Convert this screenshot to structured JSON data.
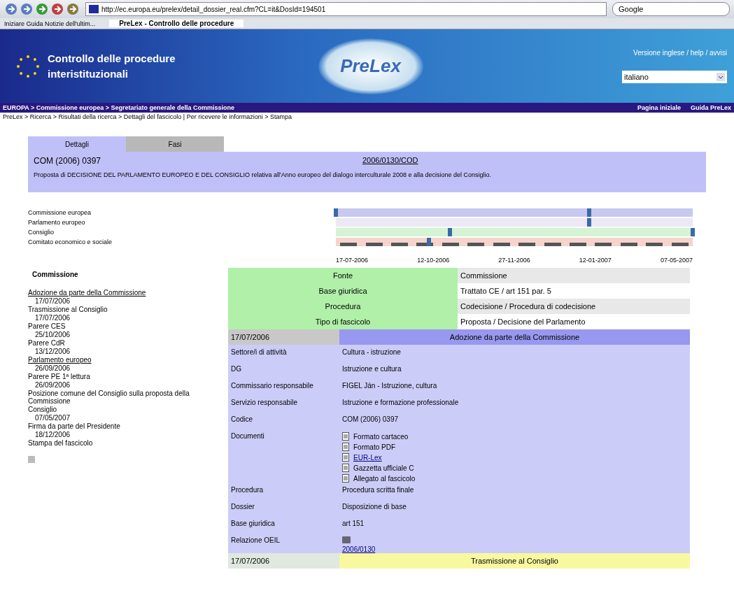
{
  "browser": {
    "url": "http://ec.europa.eu/prelex/detail_dossier_real.cfm?CL=it&DosId=194501",
    "search": "Google",
    "bookmarks": "Iniziare Guida Notizie dell'ultim..."
  },
  "tab": {
    "title": "PreLex - Controllo delle procedure"
  },
  "header": {
    "title": "Controllo delle procedure interistituzionali",
    "logo": "PreLex",
    "top_link": "Versione inglese / help / avvisi",
    "language": "italiano"
  },
  "nav_bar": {
    "left": "EUROPA > Commissione europea > Segretariato generale della Commissione",
    "right": [
      {
        "label": "Pagina iniziale"
      },
      {
        "label": "Guida PreLex"
      }
    ]
  },
  "breadcrumb": "PreLex > Ricerca > Risultati della ricerca > Dettagli del fascicolo | Per ricevere le informazioni > Stampa",
  "tabs": [
    {
      "label": "Dettagli",
      "selected": true
    },
    {
      "label": "Fasi",
      "selected": false
    }
  ],
  "dossier": {
    "label": "COM (2006) 0397",
    "link": "2006/0130/COD",
    "summary": "Proposta di DECISIONE DEL PARLAMENTO EUROPEO E DEL CONSIGLIO relativa all'Anno europeo del dialogo interculturale 2008 e alla decisione del Consiglio."
  },
  "timeline": {
    "rows": [
      {
        "label": "Commissione europea",
        "color": "#c8c8f0"
      },
      {
        "label": "Parlamento europeo",
        "color": "#ece8f4"
      },
      {
        "label": "Consiglio",
        "color": "#d4f4d4"
      },
      {
        "label": "Comitato economico e sociale",
        "color": "#f4d4cc"
      }
    ],
    "dates": [
      "17-07-2006",
      "12-10-2006",
      "27-11-2006",
      "12-01-2007",
      "07-05-2007"
    ]
  },
  "sidebar": {
    "title": "Commissione",
    "items": [
      {
        "text": "Adozione da parte della Commissione",
        "kind": "link"
      },
      {
        "text": "17/07/2006",
        "kind": "date"
      },
      {
        "text": "Trasmissione al Consiglio",
        "kind": "plain"
      },
      {
        "text": "17/07/2006",
        "kind": "date"
      },
      {
        "text": "Parere CES",
        "kind": "plain"
      },
      {
        "text": "25/10/2006",
        "kind": "date"
      },
      {
        "text": "Parere CdR",
        "kind": "plain"
      },
      {
        "text": "13/12/2006",
        "kind": "date"
      },
      {
        "text": "Parlamento europeo",
        "kind": "link"
      },
      {
        "text": "26/09/2006",
        "kind": "date"
      },
      {
        "text": "Parere PE 1ª lettura",
        "kind": "plain"
      },
      {
        "text": "26/09/2006",
        "kind": "date"
      },
      {
        "text": "Posizione comune del Consiglio sulla proposta della Commissione",
        "kind": "plain"
      },
      {
        "text": "Consiglio",
        "kind": "plain"
      },
      {
        "text": "07/05/2007",
        "kind": "date"
      },
      {
        "text": "Firma da parte del Presidente",
        "kind": "plain"
      },
      {
        "text": "18/12/2006",
        "kind": "date"
      },
      {
        "text": "Stampa del fascicolo",
        "kind": "plain"
      }
    ]
  },
  "info_rows": [
    {
      "label": "Fonte",
      "value": "Commissione"
    },
    {
      "label": "Base giuridica",
      "value": "Trattato CE / art 151 par. 5"
    },
    {
      "label": "Procedura",
      "value": "Codecisione / Procedura di codecisione"
    },
    {
      "label": "Tipo di fascicolo",
      "value": "Proposta / Decisione del Parlamento"
    }
  ],
  "event": {
    "label": "17/07/2006",
    "title": "Adozione da parte della Commissione",
    "rows": [
      {
        "label": "Settore/i di attività",
        "value": "Cultura - istruzione",
        "kind": "text"
      },
      {
        "label": "DG",
        "value": "Istruzione e cultura",
        "kind": "text"
      },
      {
        "label": "Commissario responsabile",
        "value": "FIGEL Ján - Istruzione, cultura",
        "kind": "text"
      },
      {
        "label": "Servizio responsabile",
        "value": "Istruzione e formazione professionale",
        "kind": "text"
      },
      {
        "label": "Codice",
        "value": "COM (2006) 0397",
        "kind": "text"
      },
      {
        "label": "Documenti",
        "kind": "docs",
        "docs": [
          {
            "text": "Formato cartaceo",
            "link": false
          },
          {
            "text": "Formato PDF",
            "link": false
          },
          {
            "text": "EUR-Lex",
            "link": true
          },
          {
            "text": "Gazzetta ufficiale C",
            "link": false
          },
          {
            "text": "Allegato al fascicolo",
            "link": false
          }
        ]
      },
      {
        "label": "Procedura",
        "value": "Procedura scritta finale",
        "kind": "text"
      },
      {
        "label": "Dossier",
        "value": "Disposizione di base",
        "kind": "text"
      },
      {
        "label": "Base giuridica",
        "value": "art 151",
        "kind": "text"
      },
      {
        "label": "Relazione OEIL",
        "value": "2006/0130",
        "kind": "link"
      }
    ]
  },
  "next_event": {
    "label": "17/07/2006",
    "title": "Trasmissione al Consiglio"
  }
}
